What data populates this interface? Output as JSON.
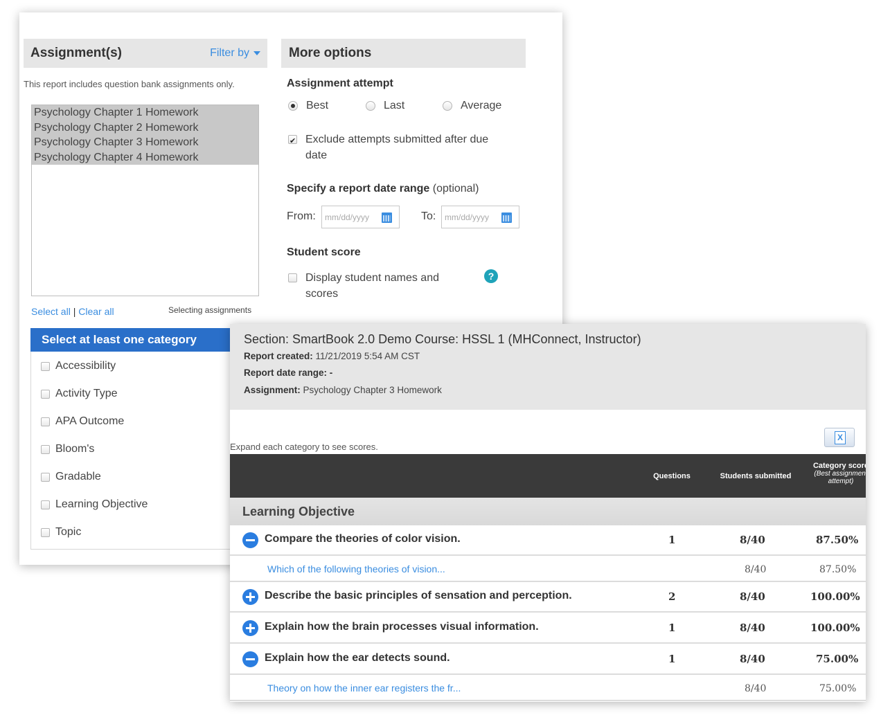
{
  "settings": {
    "assignments": {
      "title": "Assignment(s)",
      "filter_label": "Filter by",
      "note": "This report includes question bank assignments only.",
      "items": [
        "Psychology Chapter 1 Homework",
        "Psychology Chapter 2 Homework",
        "Psychology Chapter 3 Homework",
        "Psychology Chapter 4 Homework"
      ],
      "select_all": "Select all",
      "separator": "|",
      "clear_all": "Clear all",
      "caption": "Selecting assignments"
    },
    "category": {
      "title": "Select at least one category",
      "items": [
        "Accessibility",
        "Activity Type",
        "APA Outcome",
        "Bloom's",
        "Gradable",
        "Learning Objective",
        "Topic"
      ]
    },
    "more_options": {
      "title": "More options",
      "attempt_label": "Assignment attempt",
      "attempt_options": [
        "Best",
        "Last",
        "Average"
      ],
      "attempt_selected": "Best",
      "exclude_late_label": "Exclude attempts submitted after due date",
      "exclude_late_checked": true,
      "date_range_label": "Specify a report date range",
      "date_range_optional": "(optional)",
      "from_label": "From:",
      "to_label": "To:",
      "date_placeholder": "mm/dd/yyyy",
      "student_score_label": "Student score",
      "display_names_label": "Display student names and scores",
      "display_names_checked": false,
      "help_symbol": "?"
    }
  },
  "report": {
    "section_title": "Section: SmartBook 2.0 Demo Course: HSSL 1 (MHConnect, Instructor)",
    "created_label": "Report created:",
    "created_value": "11/21/2019 5:54 AM CST",
    "date_range_label": "Report date range:",
    "date_range_value": "-",
    "assignment_label": "Assignment:",
    "assignment_value": "Psychology Chapter 3 Homework",
    "expand_note": "Expand each category to see scores.",
    "excel_symbol": "X",
    "columns": {
      "questions": "Questions",
      "students_submitted": "Students submitted",
      "category_score": "Category score",
      "category_score_sub": "(Best assignment attempt)"
    },
    "group": "Learning Objective",
    "rows": [
      {
        "type": "main",
        "expanded": true,
        "text": "Compare the theories of color vision.",
        "questions": "1",
        "submitted": "8/40",
        "score": "87.50%"
      },
      {
        "type": "sub",
        "text": "Which of the following theories of vision...",
        "submitted": "8/40",
        "score": "87.50%"
      },
      {
        "type": "main",
        "expanded": false,
        "text": "Describe the basic principles of sensation and perception.",
        "questions": "2",
        "submitted": "8/40",
        "score": "100.00%"
      },
      {
        "type": "main",
        "expanded": false,
        "text": "Explain how the brain processes visual information.",
        "questions": "1",
        "submitted": "8/40",
        "score": "100.00%"
      },
      {
        "type": "main",
        "expanded": true,
        "text": "Explain how the ear detects sound.",
        "questions": "1",
        "submitted": "8/40",
        "score": "75.00%"
      },
      {
        "type": "sub",
        "text": "Theory on how the inner ear registers the fr...",
        "submitted": "8/40",
        "score": "75.00%"
      }
    ]
  }
}
